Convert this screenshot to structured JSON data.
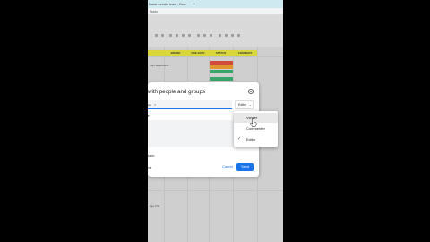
{
  "browser": {
    "tab_title": "ficado website team - Goo",
    "tab_close": "×",
    "tab_new": "+",
    "address": "ficado"
  },
  "sheet": {
    "headers": [
      "BRAND",
      "DUE DATE",
      "STATUS",
      "COMMENT"
    ],
    "cell_a": "Sign awareness",
    "cell_b": "age 2 lin",
    "status_colors": [
      "#d04a3c",
      "#e0962c",
      "#3aa56b",
      "#3aa56b"
    ]
  },
  "dialog": {
    "title": "with people and groups",
    "chip_text": "am",
    "chip_close": "×",
    "role_label": "Editor",
    "role_caret": "⌄",
    "notify_label": "e",
    "message_hint": "ssion",
    "copy_link": "nk",
    "cancel_label": "Cancel",
    "send_label": "Send"
  },
  "role_menu": {
    "items": [
      "Viewer",
      "Commenter",
      "Editor"
    ],
    "selected": "Editor",
    "check": "✓"
  },
  "colors": {
    "accent": "#1a73e8",
    "header_yellow": "#d9d63b"
  }
}
